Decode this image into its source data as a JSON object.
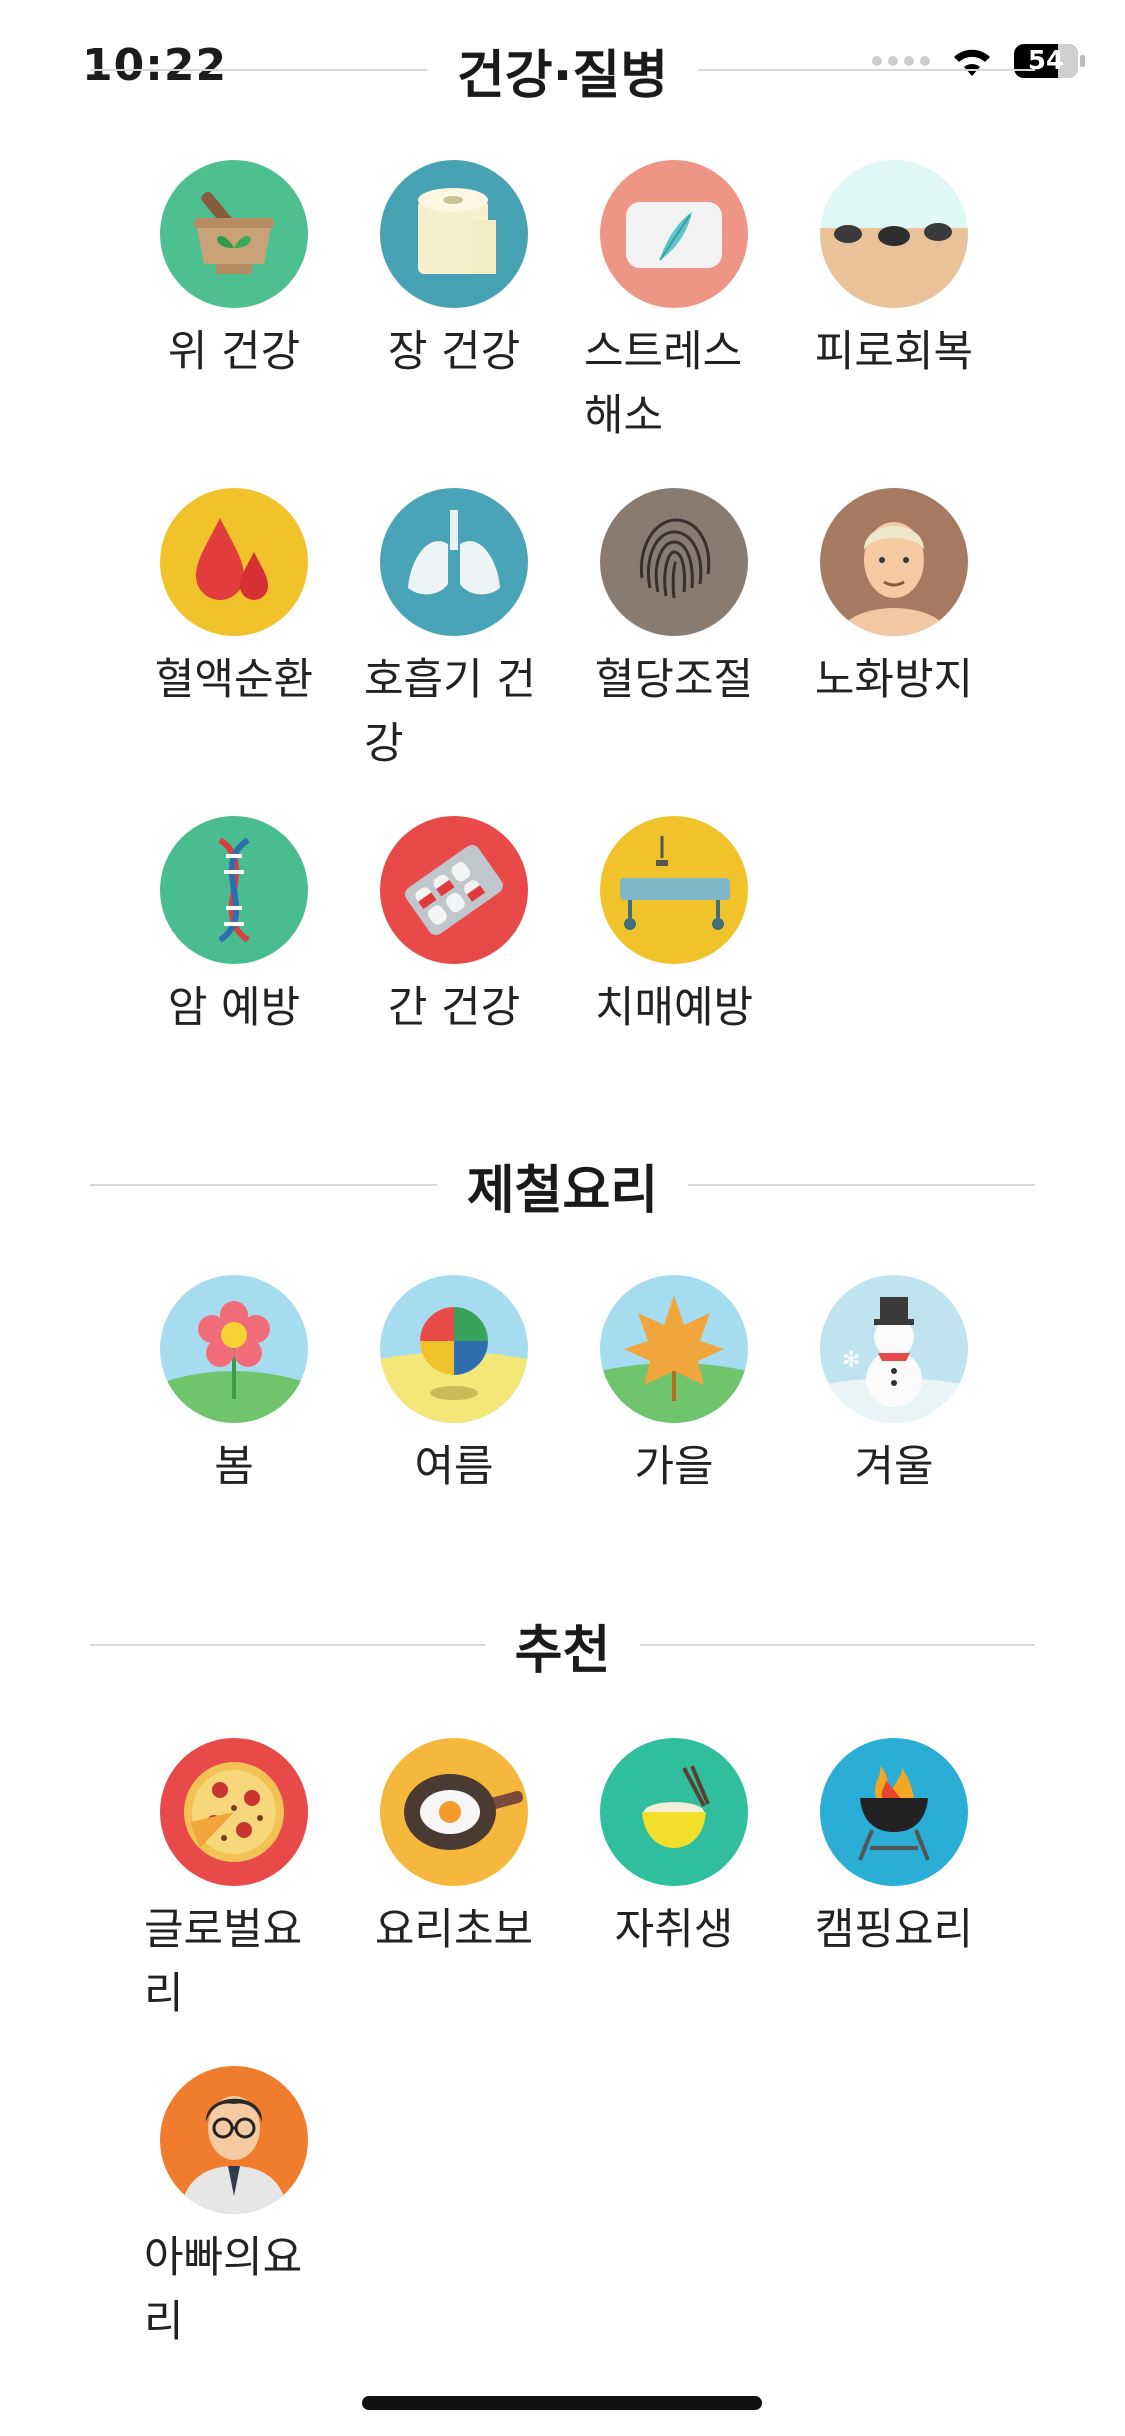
{
  "status": {
    "time": "10:22",
    "battery": "54"
  },
  "sections": [
    {
      "title": "건강·질병",
      "items": [
        {
          "label": "위 건강",
          "icon": "mortar-herb-icon",
          "bg": "#4dbf91"
        },
        {
          "label": "장 건강",
          "icon": "toilet-paper-icon",
          "bg": "#47a3b3"
        },
        {
          "label": "스트레스 해소",
          "icon": "pillow-feather-icon",
          "bg": "#ee9685"
        },
        {
          "label": "피로회복",
          "icon": "hot-stones-icon",
          "bg": "#e9c29a"
        },
        {
          "label": "혈액순환",
          "icon": "blood-drops-icon",
          "bg": "#f0c32b"
        },
        {
          "label": "호흡기 건강",
          "icon": "lungs-icon",
          "bg": "#4aa4b7"
        },
        {
          "label": "혈당조절",
          "icon": "fingerprint-icon",
          "bg": "#8a7b70"
        },
        {
          "label": "노화방지",
          "icon": "old-man-face-icon",
          "bg": "#a57a60"
        },
        {
          "label": "암 예방",
          "icon": "dna-icon",
          "bg": "#49bc92"
        },
        {
          "label": "간 건강",
          "icon": "pill-pack-icon",
          "bg": "#e84a4a"
        },
        {
          "label": "치매예방",
          "icon": "hospital-bed-icon",
          "bg": "#f0c32b"
        }
      ]
    },
    {
      "title": "제철요리",
      "items": [
        {
          "label": "봄",
          "icon": "flower-icon",
          "bg": "#a6dcef"
        },
        {
          "label": "여름",
          "icon": "beach-ball-icon",
          "bg": "#a6dcef"
        },
        {
          "label": "가을",
          "icon": "maple-leaf-icon",
          "bg": "#a6dcef"
        },
        {
          "label": "겨울",
          "icon": "snowman-icon",
          "bg": "#bfe3ef"
        }
      ]
    },
    {
      "title": "추천",
      "items": [
        {
          "label": "글로벌요리",
          "icon": "pizza-icon",
          "bg": "#e84a4a"
        },
        {
          "label": "요리초보",
          "icon": "frying-pan-egg-icon",
          "bg": "#f6b83c"
        },
        {
          "label": "자취생",
          "icon": "noodle-bowl-icon",
          "bg": "#2fbf9f"
        },
        {
          "label": "캠핑요리",
          "icon": "grill-icon",
          "bg": "#2aaed6"
        },
        {
          "label": "아빠의요리",
          "icon": "dad-glasses-icon",
          "bg": "#f07c2e"
        }
      ]
    }
  ]
}
